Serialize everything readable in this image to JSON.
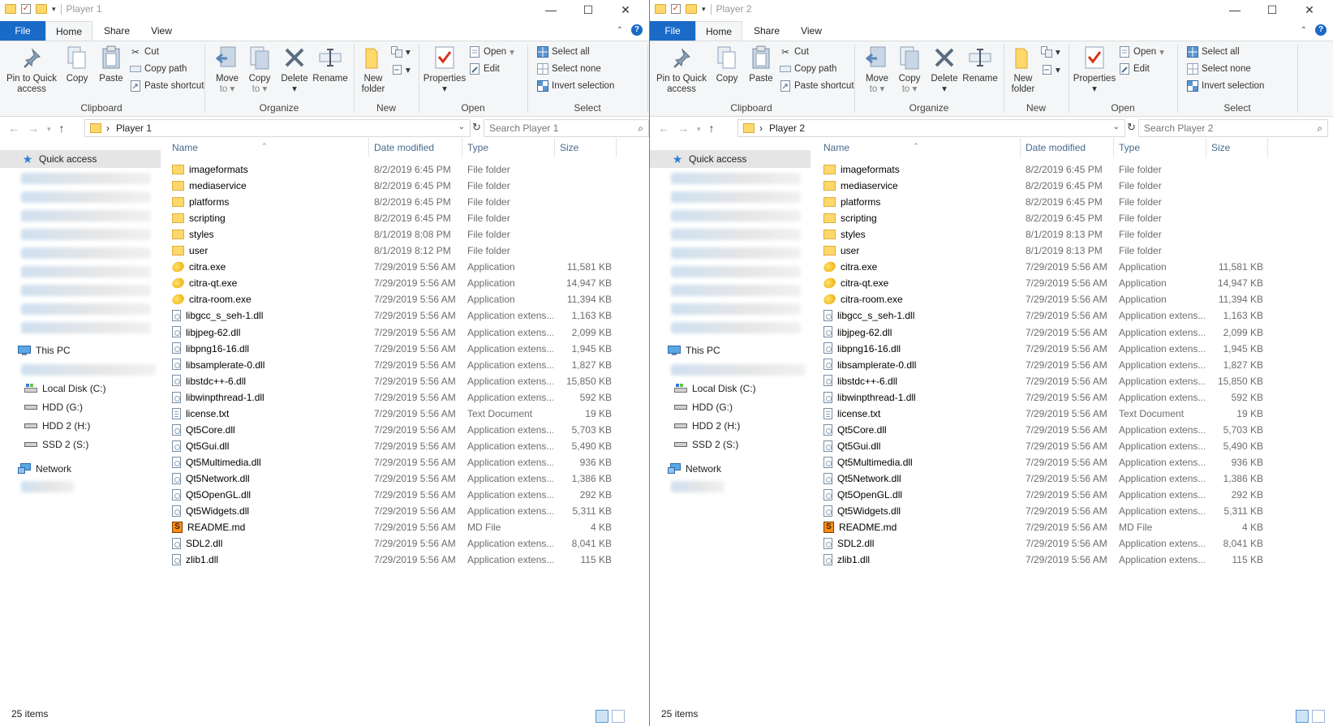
{
  "ribbon": {
    "tabs": {
      "file": "File",
      "home": "Home",
      "share": "Share",
      "view": "View"
    },
    "clipboard": {
      "pin_l1": "Pin to Quick",
      "pin_l2": "access",
      "copy": "Copy",
      "paste": "Paste",
      "cut": "Cut",
      "copy_path": "Copy path",
      "paste_shortcut": "Paste shortcut",
      "label": "Clipboard"
    },
    "organize": {
      "move_l1": "Move",
      "move_l2": "to",
      "copy_l1": "Copy",
      "copy_l2": "to",
      "delete": "Delete",
      "rename": "Rename",
      "label": "Organize"
    },
    "new": {
      "folder_l1": "New",
      "folder_l2": "folder",
      "label": "New"
    },
    "open": {
      "properties": "Properties",
      "open": "Open",
      "edit": "Edit",
      "label": "Open"
    },
    "select": {
      "all": "Select all",
      "none": "Select none",
      "invert": "Invert selection",
      "label": "Select"
    }
  },
  "columns": {
    "name": "Name",
    "date": "Date modified",
    "type": "Type",
    "size": "Size"
  },
  "nav": {
    "quick_access": "Quick access",
    "this_pc": "This PC",
    "local_disk": "Local Disk (C:)",
    "hdd_g": "HDD (G:)",
    "hdd2_h": "HDD 2 (H:)",
    "ssd2_s": "SSD 2 (S:)",
    "network": "Network"
  },
  "windows": [
    {
      "title": "Player 1",
      "breadcrumb": "Player 1",
      "search_placeholder": "Search Player 1",
      "status": "25 items",
      "files": [
        {
          "icon": "folder",
          "name": "imageformats",
          "date": "8/2/2019 6:45 PM",
          "type": "File folder",
          "size": ""
        },
        {
          "icon": "folder",
          "name": "mediaservice",
          "date": "8/2/2019 6:45 PM",
          "type": "File folder",
          "size": ""
        },
        {
          "icon": "folder",
          "name": "platforms",
          "date": "8/2/2019 6:45 PM",
          "type": "File folder",
          "size": ""
        },
        {
          "icon": "folder",
          "name": "scripting",
          "date": "8/2/2019 6:45 PM",
          "type": "File folder",
          "size": ""
        },
        {
          "icon": "folder",
          "name": "styles",
          "date": "8/1/2019 8:08 PM",
          "type": "File folder",
          "size": ""
        },
        {
          "icon": "folder",
          "name": "user",
          "date": "8/1/2019 8:12 PM",
          "type": "File folder",
          "size": ""
        },
        {
          "icon": "exe",
          "name": "citra.exe",
          "date": "7/29/2019 5:56 AM",
          "type": "Application",
          "size": "11,581 KB"
        },
        {
          "icon": "exe",
          "name": "citra-qt.exe",
          "date": "7/29/2019 5:56 AM",
          "type": "Application",
          "size": "14,947 KB"
        },
        {
          "icon": "exe",
          "name": "citra-room.exe",
          "date": "7/29/2019 5:56 AM",
          "type": "Application",
          "size": "11,394 KB"
        },
        {
          "icon": "dll",
          "name": "libgcc_s_seh-1.dll",
          "date": "7/29/2019 5:56 AM",
          "type": "Application extens...",
          "size": "1,163 KB"
        },
        {
          "icon": "dll",
          "name": "libjpeg-62.dll",
          "date": "7/29/2019 5:56 AM",
          "type": "Application extens...",
          "size": "2,099 KB"
        },
        {
          "icon": "dll",
          "name": "libpng16-16.dll",
          "date": "7/29/2019 5:56 AM",
          "type": "Application extens...",
          "size": "1,945 KB"
        },
        {
          "icon": "dll",
          "name": "libsamplerate-0.dll",
          "date": "7/29/2019 5:56 AM",
          "type": "Application extens...",
          "size": "1,827 KB"
        },
        {
          "icon": "dll",
          "name": "libstdc++-6.dll",
          "date": "7/29/2019 5:56 AM",
          "type": "Application extens...",
          "size": "15,850 KB"
        },
        {
          "icon": "dll",
          "name": "libwinpthread-1.dll",
          "date": "7/29/2019 5:56 AM",
          "type": "Application extens...",
          "size": "592 KB"
        },
        {
          "icon": "txt",
          "name": "license.txt",
          "date": "7/29/2019 5:56 AM",
          "type": "Text Document",
          "size": "19 KB"
        },
        {
          "icon": "dll",
          "name": "Qt5Core.dll",
          "date": "7/29/2019 5:56 AM",
          "type": "Application extens...",
          "size": "5,703 KB"
        },
        {
          "icon": "dll",
          "name": "Qt5Gui.dll",
          "date": "7/29/2019 5:56 AM",
          "type": "Application extens...",
          "size": "5,490 KB"
        },
        {
          "icon": "dll",
          "name": "Qt5Multimedia.dll",
          "date": "7/29/2019 5:56 AM",
          "type": "Application extens...",
          "size": "936 KB"
        },
        {
          "icon": "dll",
          "name": "Qt5Network.dll",
          "date": "7/29/2019 5:56 AM",
          "type": "Application extens...",
          "size": "1,386 KB"
        },
        {
          "icon": "dll",
          "name": "Qt5OpenGL.dll",
          "date": "7/29/2019 5:56 AM",
          "type": "Application extens...",
          "size": "292 KB"
        },
        {
          "icon": "dll",
          "name": "Qt5Widgets.dll",
          "date": "7/29/2019 5:56 AM",
          "type": "Application extens...",
          "size": "5,311 KB"
        },
        {
          "icon": "md",
          "name": "README.md",
          "date": "7/29/2019 5:56 AM",
          "type": "MD File",
          "size": "4 KB"
        },
        {
          "icon": "dll",
          "name": "SDL2.dll",
          "date": "7/29/2019 5:56 AM",
          "type": "Application extens...",
          "size": "8,041 KB"
        },
        {
          "icon": "dll",
          "name": "zlib1.dll",
          "date": "7/29/2019 5:56 AM",
          "type": "Application extens...",
          "size": "115 KB"
        }
      ]
    },
    {
      "title": "Player 2",
      "breadcrumb": "Player 2",
      "search_placeholder": "Search Player 2",
      "status": "25 items",
      "files": [
        {
          "icon": "folder",
          "name": "imageformats",
          "date": "8/2/2019 6:45 PM",
          "type": "File folder",
          "size": ""
        },
        {
          "icon": "folder",
          "name": "mediaservice",
          "date": "8/2/2019 6:45 PM",
          "type": "File folder",
          "size": ""
        },
        {
          "icon": "folder",
          "name": "platforms",
          "date": "8/2/2019 6:45 PM",
          "type": "File folder",
          "size": ""
        },
        {
          "icon": "folder",
          "name": "scripting",
          "date": "8/2/2019 6:45 PM",
          "type": "File folder",
          "size": ""
        },
        {
          "icon": "folder",
          "name": "styles",
          "date": "8/1/2019 8:13 PM",
          "type": "File folder",
          "size": ""
        },
        {
          "icon": "folder",
          "name": "user",
          "date": "8/1/2019 8:13 PM",
          "type": "File folder",
          "size": ""
        },
        {
          "icon": "exe",
          "name": "citra.exe",
          "date": "7/29/2019 5:56 AM",
          "type": "Application",
          "size": "11,581 KB"
        },
        {
          "icon": "exe",
          "name": "citra-qt.exe",
          "date": "7/29/2019 5:56 AM",
          "type": "Application",
          "size": "14,947 KB"
        },
        {
          "icon": "exe",
          "name": "citra-room.exe",
          "date": "7/29/2019 5:56 AM",
          "type": "Application",
          "size": "11,394 KB"
        },
        {
          "icon": "dll",
          "name": "libgcc_s_seh-1.dll",
          "date": "7/29/2019 5:56 AM",
          "type": "Application extens...",
          "size": "1,163 KB"
        },
        {
          "icon": "dll",
          "name": "libjpeg-62.dll",
          "date": "7/29/2019 5:56 AM",
          "type": "Application extens...",
          "size": "2,099 KB"
        },
        {
          "icon": "dll",
          "name": "libpng16-16.dll",
          "date": "7/29/2019 5:56 AM",
          "type": "Application extens...",
          "size": "1,945 KB"
        },
        {
          "icon": "dll",
          "name": "libsamplerate-0.dll",
          "date": "7/29/2019 5:56 AM",
          "type": "Application extens...",
          "size": "1,827 KB"
        },
        {
          "icon": "dll",
          "name": "libstdc++-6.dll",
          "date": "7/29/2019 5:56 AM",
          "type": "Application extens...",
          "size": "15,850 KB"
        },
        {
          "icon": "dll",
          "name": "libwinpthread-1.dll",
          "date": "7/29/2019 5:56 AM",
          "type": "Application extens...",
          "size": "592 KB"
        },
        {
          "icon": "txt",
          "name": "license.txt",
          "date": "7/29/2019 5:56 AM",
          "type": "Text Document",
          "size": "19 KB"
        },
        {
          "icon": "dll",
          "name": "Qt5Core.dll",
          "date": "7/29/2019 5:56 AM",
          "type": "Application extens...",
          "size": "5,703 KB"
        },
        {
          "icon": "dll",
          "name": "Qt5Gui.dll",
          "date": "7/29/2019 5:56 AM",
          "type": "Application extens...",
          "size": "5,490 KB"
        },
        {
          "icon": "dll",
          "name": "Qt5Multimedia.dll",
          "date": "7/29/2019 5:56 AM",
          "type": "Application extens...",
          "size": "936 KB"
        },
        {
          "icon": "dll",
          "name": "Qt5Network.dll",
          "date": "7/29/2019 5:56 AM",
          "type": "Application extens...",
          "size": "1,386 KB"
        },
        {
          "icon": "dll",
          "name": "Qt5OpenGL.dll",
          "date": "7/29/2019 5:56 AM",
          "type": "Application extens...",
          "size": "292 KB"
        },
        {
          "icon": "dll",
          "name": "Qt5Widgets.dll",
          "date": "7/29/2019 5:56 AM",
          "type": "Application extens...",
          "size": "5,311 KB"
        },
        {
          "icon": "md",
          "name": "README.md",
          "date": "7/29/2019 5:56 AM",
          "type": "MD File",
          "size": "4 KB"
        },
        {
          "icon": "dll",
          "name": "SDL2.dll",
          "date": "7/29/2019 5:56 AM",
          "type": "Application extens...",
          "size": "8,041 KB"
        },
        {
          "icon": "dll",
          "name": "zlib1.dll",
          "date": "7/29/2019 5:56 AM",
          "type": "Application extens...",
          "size": "115 KB"
        }
      ]
    }
  ]
}
